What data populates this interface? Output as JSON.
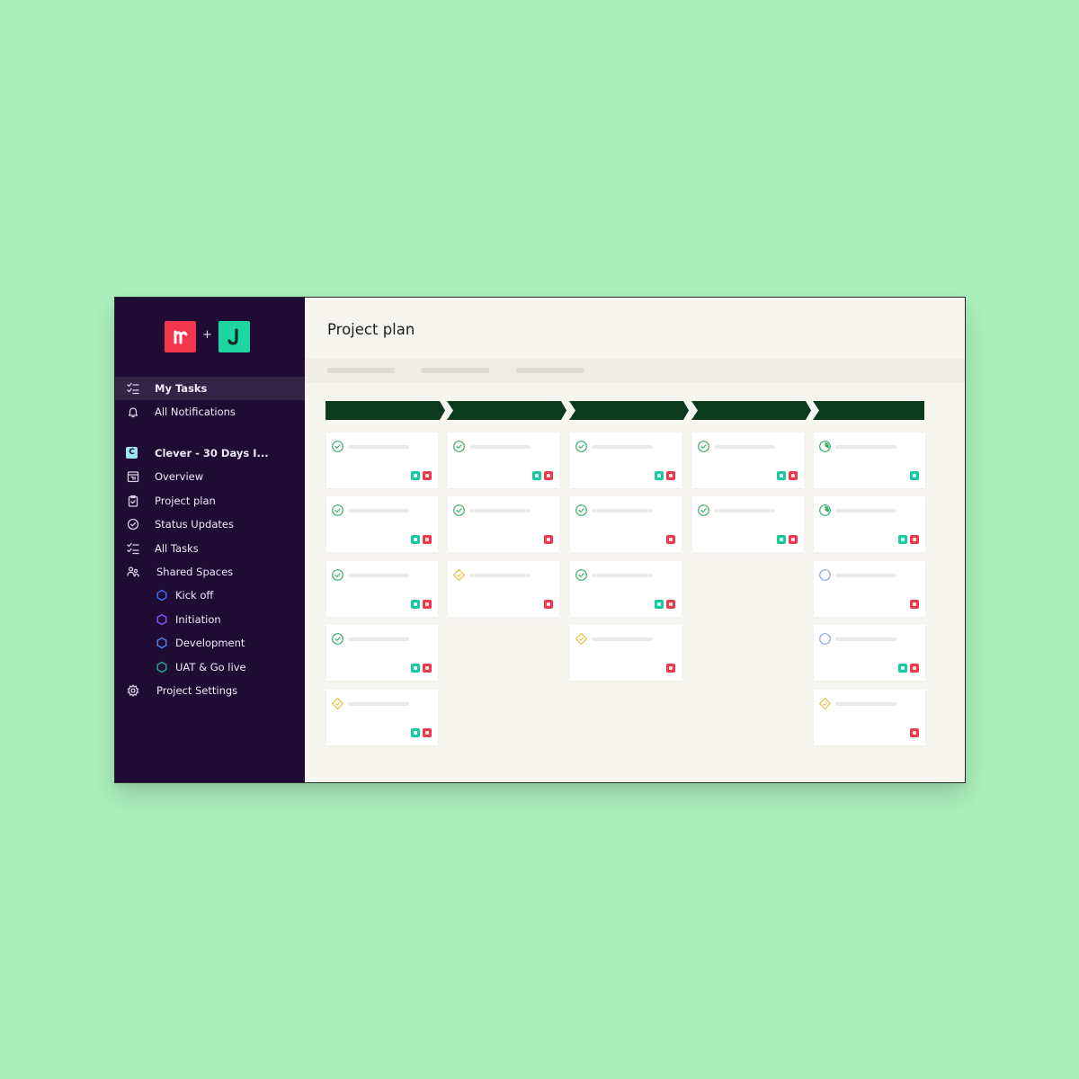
{
  "colors": {
    "background": "#abefbd",
    "sidebar": "#1f0b33",
    "phase_header": "#0c3a1d",
    "jira_badge": "#19c9a0",
    "monday_badge": "#ec3a4c",
    "done": "#3faf6b",
    "at_risk": "#e6c33d",
    "todo": "#8aa5e0"
  },
  "brand": {
    "plus": "+"
  },
  "sidebar": {
    "top": [
      {
        "label": "My Tasks",
        "icon": "tasks-list-icon",
        "active": true
      },
      {
        "label": "All Notifications",
        "icon": "bell-icon"
      }
    ],
    "project": {
      "badge": "C",
      "label": "Clever - 30 Days I..."
    },
    "items": [
      {
        "label": "Overview",
        "icon": "calendar-icon"
      },
      {
        "label": "Project plan",
        "icon": "clipboard-icon"
      },
      {
        "label": "Status Updates",
        "icon": "check-circle-icon"
      },
      {
        "label": "All Tasks",
        "icon": "tasks-list-icon"
      },
      {
        "label": "Shared Spaces",
        "icon": "users-icon"
      }
    ],
    "spaces": [
      {
        "label": "Kick off",
        "color": "#3d6df0"
      },
      {
        "label": "Initiation",
        "color": "#8a4df0"
      },
      {
        "label": "Development",
        "color": "#4a82f0"
      },
      {
        "label": "UAT & Go live",
        "color": "#1ea88e"
      }
    ],
    "settings": {
      "label": "Project Settings",
      "icon": "gear-icon"
    }
  },
  "main": {
    "title": "Project plan",
    "tabs_count": 3
  },
  "board": {
    "columns": [
      {
        "cards": [
          {
            "status": "done",
            "badges": [
              "jira",
              "monday"
            ]
          },
          {
            "status": "done",
            "badges": [
              "jira",
              "monday"
            ]
          },
          {
            "status": "done",
            "badges": [
              "jira",
              "monday"
            ]
          },
          {
            "status": "done",
            "badges": [
              "jira",
              "monday"
            ]
          },
          {
            "status": "at-risk",
            "badges": [
              "jira",
              "monday"
            ]
          }
        ]
      },
      {
        "cards": [
          {
            "status": "done",
            "badges": [
              "jira",
              "monday"
            ]
          },
          {
            "status": "done",
            "badges": [
              "monday"
            ]
          },
          {
            "status": "at-risk",
            "badges": [
              "monday"
            ]
          }
        ]
      },
      {
        "cards": [
          {
            "status": "done",
            "badges": [
              "jira",
              "monday"
            ]
          },
          {
            "status": "done",
            "badges": [
              "monday"
            ]
          },
          {
            "status": "done",
            "badges": [
              "jira",
              "monday"
            ]
          },
          {
            "status": "at-risk",
            "badges": [
              "monday"
            ]
          }
        ]
      },
      {
        "cards": [
          {
            "status": "done",
            "badges": [
              "jira",
              "monday"
            ]
          },
          {
            "status": "done",
            "badges": [
              "jira",
              "monday"
            ]
          }
        ]
      },
      {
        "cards": [
          {
            "status": "in-progress",
            "badges": [
              "jira"
            ]
          },
          {
            "status": "in-progress",
            "badges": [
              "jira",
              "monday"
            ]
          },
          {
            "status": "todo",
            "badges": [
              "monday"
            ]
          },
          {
            "status": "todo",
            "badges": [
              "jira",
              "monday"
            ]
          },
          {
            "status": "at-risk",
            "badges": [
              "monday"
            ]
          }
        ]
      }
    ]
  }
}
